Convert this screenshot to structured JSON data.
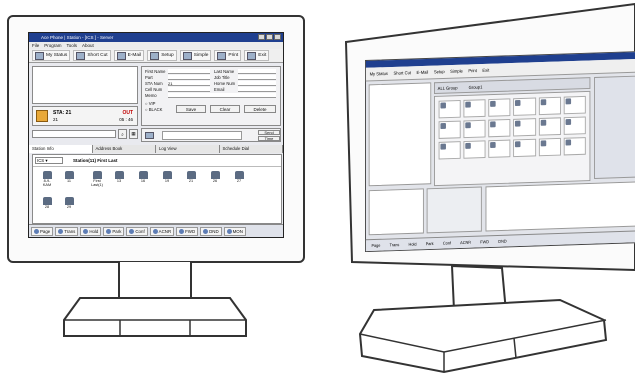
{
  "left_app": {
    "title": "Ace Phone | Station - [ICS ] - Server",
    "menu": [
      "File",
      "Program",
      "Tools",
      "About"
    ],
    "toolbar": [
      {
        "label": "My Status",
        "icon": "status-icon"
      },
      {
        "label": "Short Cut",
        "icon": "shortcut-icon"
      },
      {
        "label": "E-Mail",
        "icon": "email-icon"
      },
      {
        "label": "Setup",
        "icon": "setup-icon"
      },
      {
        "label": "Simple",
        "icon": "simple-icon"
      },
      {
        "label": "Print",
        "icon": "print-icon"
      },
      {
        "label": "Exit",
        "icon": "exit-icon"
      }
    ],
    "contact_fields_left": [
      "First Name",
      "Part",
      "STA Num",
      "Cell Num",
      "Memo"
    ],
    "contact_fields_right": [
      "Last Name",
      "Job Title",
      "Home Num",
      "Email"
    ],
    "sta_num_value": "21",
    "radio_vip": "VIP",
    "radio_black": "BLACK",
    "buttons": {
      "save": "Save",
      "clear": "Clear",
      "delete": "Delete",
      "send": "Send",
      "time": "Time"
    },
    "sta_label": "STA: 21",
    "sta_status": "OUT",
    "sta_sub": "21",
    "sta_time": "05 : 46",
    "tabs": [
      "Station Info",
      "Address Book",
      "Log View",
      "Schedule Dial"
    ],
    "station_select": "ICS",
    "station_header": "Station(11)  First Last",
    "phones": [
      {
        "num": "8-9-KAM"
      },
      {
        "num": "11"
      },
      {
        "num": "First Last(1)"
      },
      {
        "num": "13"
      },
      {
        "num": "16"
      },
      {
        "num": "19"
      },
      {
        "num": "21"
      },
      {
        "num": "26"
      },
      {
        "num": "27"
      },
      {
        "num": "28"
      },
      {
        "num": "29"
      }
    ],
    "status_buttons": [
      "Page",
      "Trans",
      "Hold",
      "Park",
      "Conf",
      "ACNR",
      "FWD",
      "DND",
      "MON"
    ]
  },
  "right_app": {
    "toolbar": [
      "My Status",
      "Short Cut",
      "E-Mail",
      "Setup",
      "Simple",
      "Print",
      "Exit"
    ],
    "tabs": [
      "ALL Group",
      "Group1"
    ],
    "cells": [
      "",
      "",
      "",
      "",
      "",
      "",
      "",
      "",
      "",
      "",
      "",
      "",
      "",
      "",
      "",
      "",
      "",
      "",
      "",
      "",
      "",
      "",
      "",
      ""
    ],
    "bottom_tabs": [
      "Page",
      "Trans",
      "Hold",
      "Park",
      "Conf",
      "ACNR",
      "FWD",
      "DND"
    ]
  },
  "colors": {
    "titlebar": "#1f3f8f",
    "toolbar": "#efefef",
    "window": "#e9eaef"
  }
}
